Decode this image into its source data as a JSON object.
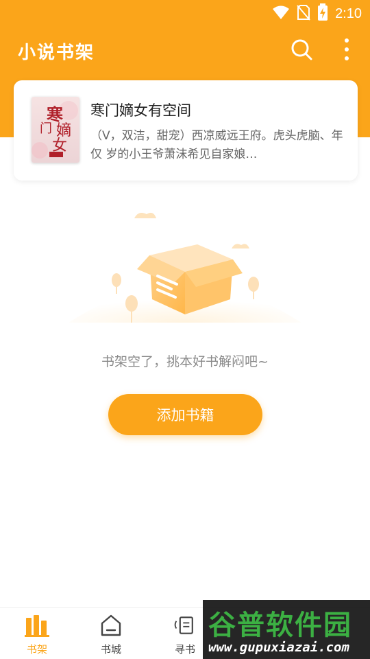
{
  "status_bar": {
    "time": "2:10",
    "icons": [
      "wifi-icon",
      "no-sim-icon",
      "battery-charging-icon"
    ]
  },
  "header": {
    "title": "小说书架",
    "icons": [
      "search-icon",
      "more-vertical-icon"
    ]
  },
  "book": {
    "title": "寒门嫡女有空间",
    "description": "（V，双洁，甜宠）西凉威远王府。虎头虎脑、年仅 岁的小王爷萧沫希见自家娘…",
    "cover_text": "寒门嫡女"
  },
  "empty_state": {
    "message": "书架空了，挑本好书解闷吧~",
    "button_label": "添加书籍"
  },
  "bottom_nav": {
    "items": [
      {
        "label": "书架",
        "icon": "bookshelf-icon",
        "active": true
      },
      {
        "label": "书城",
        "icon": "bookstore-icon",
        "active": false
      },
      {
        "label": "寻书",
        "icon": "find-book-icon",
        "active": false
      }
    ]
  },
  "watermark": {
    "name": "谷普软件园",
    "url": "www.gupuxiazai.com"
  },
  "colors": {
    "accent": "#FBA51A",
    "text_muted": "#8a8a8a",
    "watermark_green": "#3CB043"
  }
}
